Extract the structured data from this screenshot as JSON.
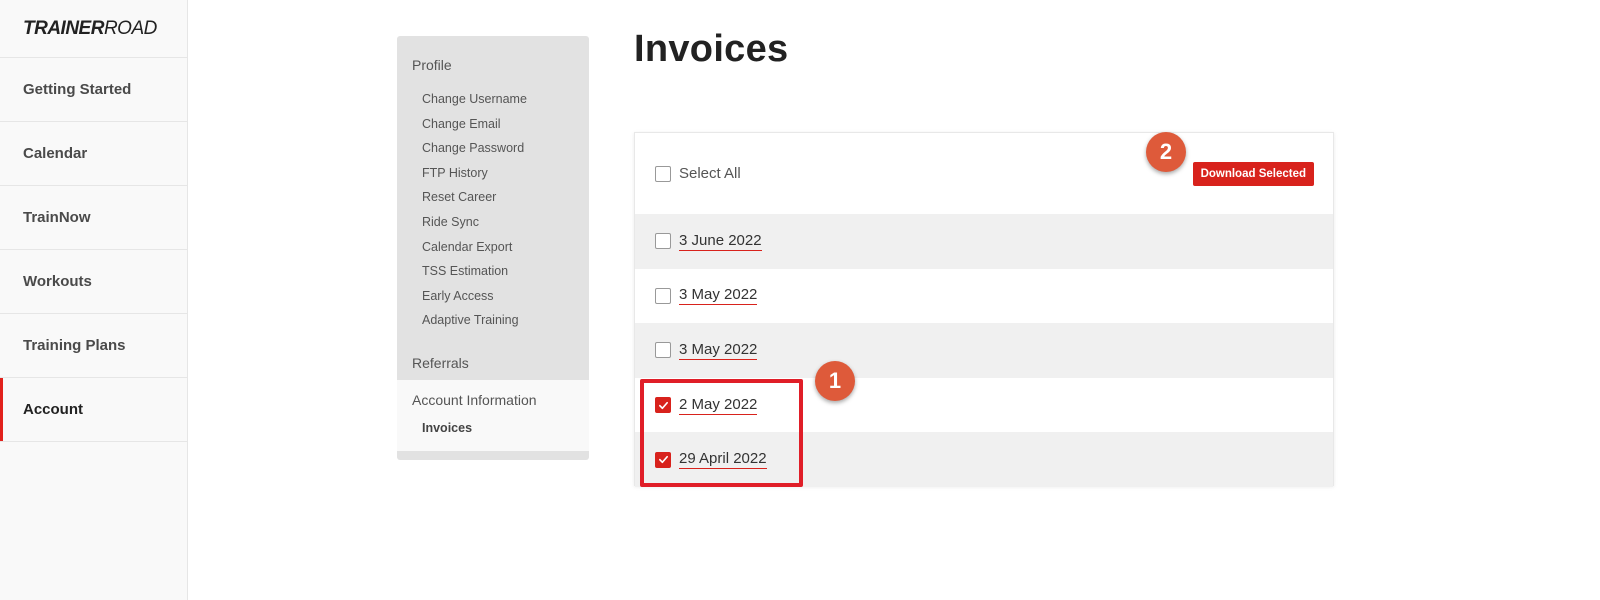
{
  "brand": {
    "part1": "TRAINER",
    "part2": "ROAD"
  },
  "nav": {
    "items": [
      {
        "label": "Getting Started"
      },
      {
        "label": "Calendar"
      },
      {
        "label": "TrainNow"
      },
      {
        "label": "Workouts"
      },
      {
        "label": "Training Plans"
      },
      {
        "label": "Account"
      }
    ],
    "active": "Account"
  },
  "submenu": {
    "profile": {
      "title": "Profile",
      "links": [
        "Change Username",
        "Change Email",
        "Change Password",
        "FTP History",
        "Reset Career",
        "Ride Sync",
        "Calendar Export",
        "TSS Estimation",
        "Early Access",
        "Adaptive Training"
      ]
    },
    "referrals": "Referrals",
    "account_info": {
      "title": "Account Information",
      "active_link": "Invoices"
    }
  },
  "page": {
    "title": "Invoices"
  },
  "invoices": {
    "select_all_label": "Select All",
    "download_label": "Download Selected",
    "rows": [
      {
        "date": "3 June 2022",
        "checked": false
      },
      {
        "date": "3 May 2022",
        "checked": false
      },
      {
        "date": "3 May 2022",
        "checked": false
      },
      {
        "date": "2 May 2022",
        "checked": true
      },
      {
        "date": "29 April 2022",
        "checked": true
      }
    ]
  },
  "annotations": {
    "badge1": "1",
    "badge2": "2"
  },
  "colors": {
    "accent": "#d8221c",
    "badge": "#de5a3a",
    "highlight": "#e01e28"
  }
}
